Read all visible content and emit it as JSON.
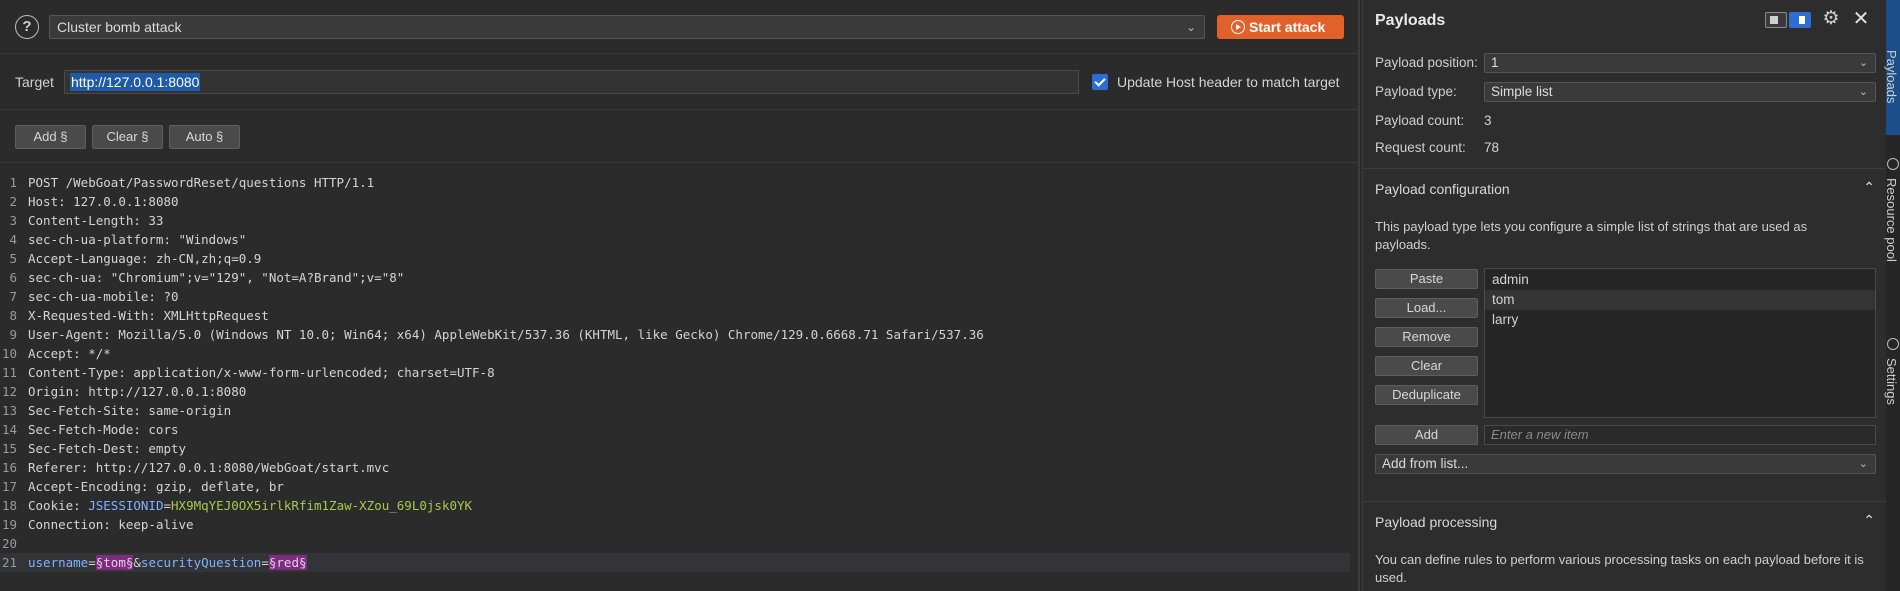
{
  "toolbar": {
    "help_glyph": "?",
    "attack_type": "Cluster bomb attack",
    "start_attack": "Start attack"
  },
  "target": {
    "label": "Target",
    "value": "http://127.0.0.1:8080",
    "update_host_label": "Update Host header to match target",
    "update_host_checked": true
  },
  "marker_buttons": {
    "add": "Add §",
    "clear": "Clear §",
    "auto": "Auto §"
  },
  "request_lines": [
    {
      "n": "1",
      "k": "POST /WebGoat/PasswordReset/questions HTTP/1.1",
      "v": ""
    },
    {
      "n": "2",
      "k": "Host",
      "v": ": 127.0.0.1:8080"
    },
    {
      "n": "3",
      "k": "Content-Length",
      "v": ": 33"
    },
    {
      "n": "4",
      "k": "sec-ch-ua-platform",
      "v": ": \"Windows\""
    },
    {
      "n": "5",
      "k": "Accept-Language",
      "v": ": zh-CN,zh;q=0.9"
    },
    {
      "n": "6",
      "k": "sec-ch-ua",
      "v": ": \"Chromium\";v=\"129\", \"Not=A?Brand\";v=\"8\""
    },
    {
      "n": "7",
      "k": "sec-ch-ua-mobile",
      "v": ": ?0"
    },
    {
      "n": "8",
      "k": "X-Requested-With",
      "v": ": XMLHttpRequest"
    },
    {
      "n": "9",
      "k": "User-Agent",
      "v": ": Mozilla/5.0 (Windows NT 10.0; Win64; x64) AppleWebKit/537.36 (KHTML, like Gecko) Chrome/129.0.6668.71 Safari/537.36"
    },
    {
      "n": "10",
      "k": "Accept",
      "v": ": */*"
    },
    {
      "n": "11",
      "k": "Content-Type",
      "v": ": application/x-www-form-urlencoded; charset=UTF-8"
    },
    {
      "n": "12",
      "k": "Origin",
      "v": ": http://127.0.0.1:8080"
    },
    {
      "n": "13",
      "k": "Sec-Fetch-Site",
      "v": ": same-origin"
    },
    {
      "n": "14",
      "k": "Sec-Fetch-Mode",
      "v": ": cors"
    },
    {
      "n": "15",
      "k": "Sec-Fetch-Dest",
      "v": ": empty"
    },
    {
      "n": "16",
      "k": "Referer",
      "v": ": http://127.0.0.1:8080/WebGoat/start.mvc"
    },
    {
      "n": "17",
      "k": "Accept-Encoding",
      "v": ": gzip, deflate, br"
    },
    {
      "n": "18",
      "k": "Cookie",
      "v": ": "
    },
    {
      "n": "19",
      "k": "Connection",
      "v": ": keep-alive"
    },
    {
      "n": "20",
      "k": "",
      "v": ""
    }
  ],
  "cookie": {
    "name": "JSESSIONID",
    "eq": "=",
    "value": "HX9MqYEJ0OX5irlkRfim1Zaw-XZou_69L0jsk0YK"
  },
  "body_line": {
    "n": "21",
    "p1": "username",
    "eq1": "=",
    "m1": "§tom§",
    "amp": "&",
    "p2": "securityQuestion",
    "eq2": "=",
    "m2": "§red§"
  },
  "payloads": {
    "title": "Payloads",
    "position_label": "Payload position:",
    "position_value": "1",
    "type_label": "Payload type:",
    "type_value": "Simple list",
    "count_label": "Payload count:",
    "count_value": "3",
    "request_label": "Request count:",
    "request_value": "78",
    "config_title": "Payload configuration",
    "config_desc": "This payload type lets you configure a simple list of strings that are used as payloads.",
    "buttons": {
      "paste": "Paste",
      "load": "Load...",
      "remove": "Remove",
      "clear": "Clear",
      "dedup": "Deduplicate",
      "add": "Add"
    },
    "items": [
      "admin",
      "tom",
      "larry"
    ],
    "new_item_placeholder": "Enter a new item",
    "add_from_list": "Add from list...",
    "processing_title": "Payload processing",
    "processing_desc": "You can define rules to perform various processing tasks on each payload before it is used."
  },
  "side_tabs": {
    "payloads": "Payloads",
    "resource_pool": "Resource pool",
    "settings": "Settings"
  }
}
